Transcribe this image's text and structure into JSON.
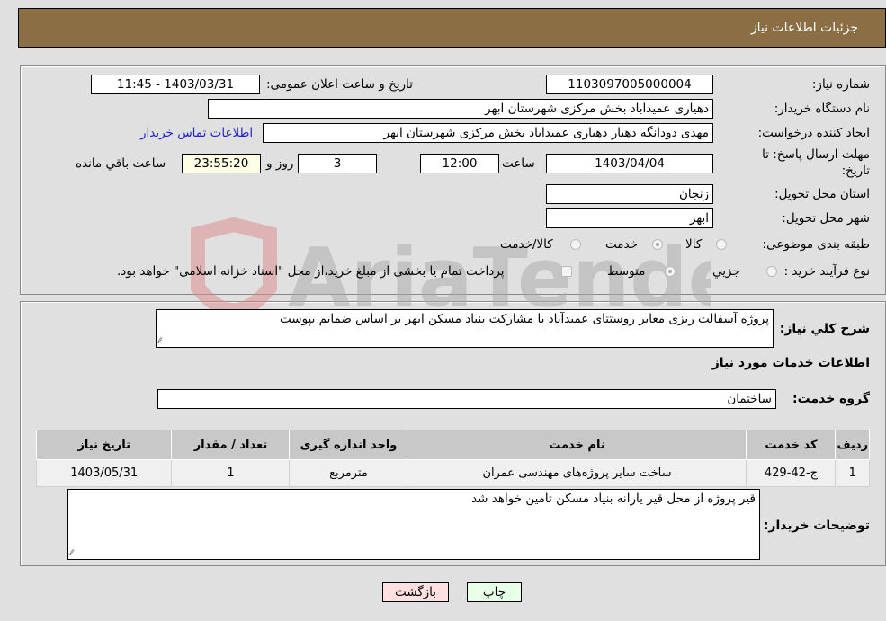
{
  "header": {
    "title": "جزئیات اطلاعات نیاز"
  },
  "fields": {
    "need_number": {
      "label": "شماره نیاز:",
      "value": "1103097005000004"
    },
    "announce_datetime": {
      "label": "تاریخ و ساعت اعلان عمومی:",
      "value": "1403/03/31 - 11:45"
    },
    "buyer_org": {
      "label": "نام دستگاه خریدار:",
      "value": "دهیاری عمیداباد بخش مرکزی شهرستان ابهر"
    },
    "requester": {
      "label": "ایجاد کننده درخواست:",
      "value": "مهدی دودانگه دهیار دهیاری عمیداباد بخش مرکزی شهرستان ابهر"
    },
    "buyer_contact_link": "اطلاعات تماس خریدار",
    "deadline": {
      "label_line1": "مهلت ارسال پاسخ: تا",
      "label_line2": "تاریخ:",
      "date": "1403/04/04",
      "time_label": "ساعت",
      "time": "12:00",
      "days": "3",
      "days_label": "روز و",
      "remaining": "23:55:20",
      "remaining_label": "ساعت باقي مانده"
    },
    "province": {
      "label": "استان محل تحویل:",
      "value": "زنجان"
    },
    "city": {
      "label": "شهر محل تحویل:",
      "value": "ابهر"
    },
    "category": {
      "label": "طبقه بندی موضوعی:",
      "options": [
        "کالا",
        "خدمت",
        "کالا/خدمت"
      ],
      "selected": "خدمت"
    },
    "purchase_process": {
      "label": "نوع فرآیند خرید :",
      "options": [
        "جزيي",
        "متوسط"
      ],
      "selected": "متوسط",
      "treasury_note": "پرداخت تمام یا بخشی از مبلغ خرید،از محل \"اسناد خزانه اسلامی\" خواهد بود."
    }
  },
  "description": {
    "label": "شرح کلي نیاز:",
    "value": "پروژه آسفالت ریزی معابر روستتای عمیدآباد با مشارکت بنیاد مسکن ابهر بر اساس ضمایم بپوست"
  },
  "services_section": {
    "title": "اطلاعات خدمات مورد نیاز",
    "group_label": "گروه خدمت:",
    "group_value": "ساختمان"
  },
  "table": {
    "headers": [
      "ردیف",
      "کد خدمت",
      "نام خدمت",
      "واحد اندازه گیری",
      "تعداد / مقدار",
      "تاریخ نیاز"
    ],
    "rows": [
      [
        "1",
        "ج-42-429",
        "ساخت سایر پروژه‌های مهندسی عمران",
        "مترمربع",
        "1",
        "1403/05/31"
      ]
    ]
  },
  "buyer_notes": {
    "label": "توضیحات خریدار:",
    "value": "قیر پروژه از محل قیر یارانه بنیاد مسکن تامین خواهد شد"
  },
  "buttons": {
    "print": "چاپ",
    "back": "بازگشت"
  },
  "watermark": {
    "text": "AriaTender.neT"
  }
}
